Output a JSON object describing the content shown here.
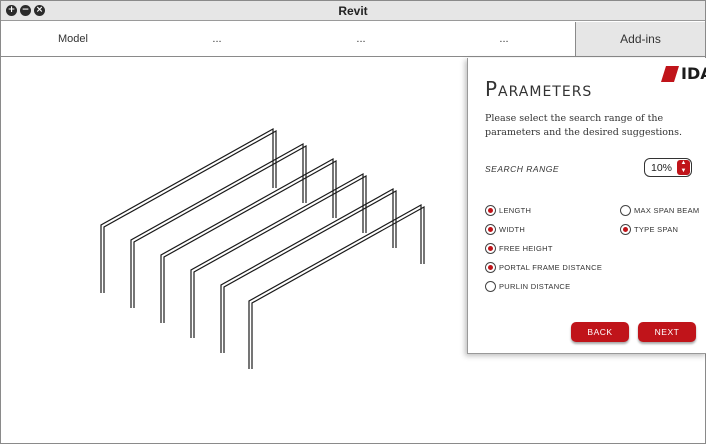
{
  "window": {
    "title": "Revit"
  },
  "ribbon": {
    "tabs": [
      {
        "label": "Model"
      },
      {
        "label": "..."
      },
      {
        "label": "..."
      },
      {
        "label": "..."
      },
      {
        "label": "Add-ins"
      }
    ]
  },
  "panel": {
    "title": "Parameters",
    "logo_text": "IDA",
    "description": "Please select the search range of the parameters and the desired suggestions.",
    "search_range": {
      "label": "SEARCH RANGE",
      "value": "10%"
    },
    "options": [
      {
        "label": "LENGTH",
        "selected": true
      },
      {
        "label": "WIDTH",
        "selected": true
      },
      {
        "label": "FREE HEIGHT",
        "selected": true
      },
      {
        "label": "PORTAL FRAME DISTANCE",
        "selected": true
      },
      {
        "label": "PURLIN DISTANCE",
        "selected": false
      },
      {
        "label": "MAX SPAN BEAM",
        "selected": false
      },
      {
        "label": "TYPE SPAN",
        "selected": true
      }
    ],
    "back_label": "BACK",
    "next_label": "NEXT"
  },
  "colors": {
    "accent": "#c0141a",
    "tab_active_bg": "#e6e6e6"
  },
  "icons": [
    "add-icon",
    "minus-icon",
    "close-icon",
    "chevron-up-icon",
    "chevron-down-icon"
  ]
}
